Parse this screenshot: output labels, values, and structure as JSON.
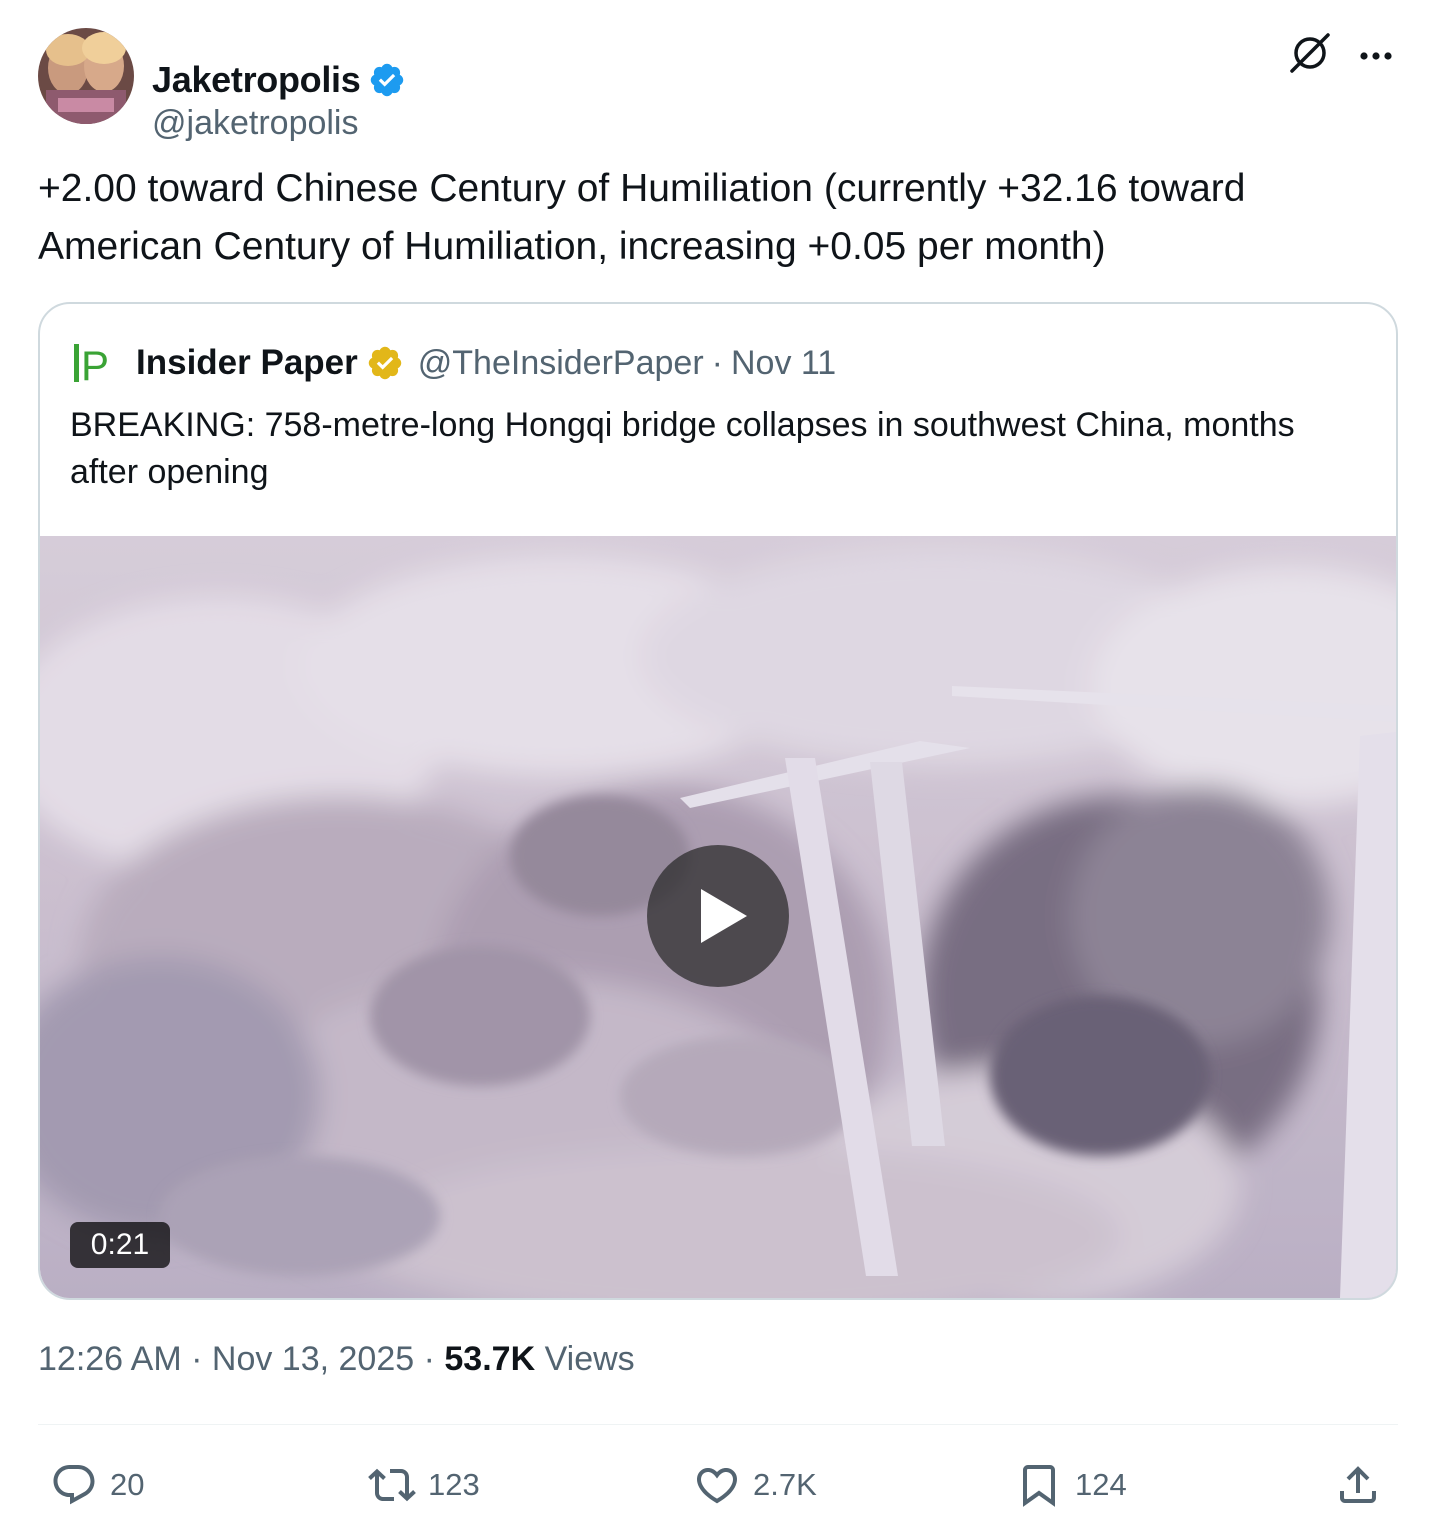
{
  "author": {
    "name": "Jaketropolis",
    "handle": "@jaketropolis"
  },
  "tweet": {
    "text": "+2.00 toward Chinese Century of Humiliation (currently +32.16 toward American Century of Humiliation, increasing +0.05 per month)"
  },
  "quoted": {
    "name": "Insider Paper",
    "handle": "@TheInsiderPaper",
    "separator": "·",
    "date": "Nov 11",
    "text": "BREAKING: 758-metre-long Hongqi bridge collapses in southwest China, months after opening",
    "logo_text": "IP",
    "video": {
      "duration": "0:21"
    }
  },
  "meta": {
    "time": "12:26 AM",
    "separator": "·",
    "date": "Nov 13, 2025",
    "views_count": "53.7K",
    "views_label": "Views"
  },
  "actions": {
    "replies": "20",
    "reposts": "123",
    "likes": "2.7K",
    "bookmarks": "124"
  },
  "colors": {
    "verified_blue": "#1d9bf0",
    "verified_gold": "#e2b719",
    "secondary_text": "#536471",
    "primary_text": "#0f1419",
    "border": "#cfd9de",
    "ip_logo_green": "#3aa335"
  },
  "icons": [
    "grok-icon",
    "more-icon",
    "verified-badge-icon",
    "play-icon",
    "reply-icon",
    "repost-icon",
    "like-icon",
    "bookmark-icon",
    "share-icon"
  ]
}
